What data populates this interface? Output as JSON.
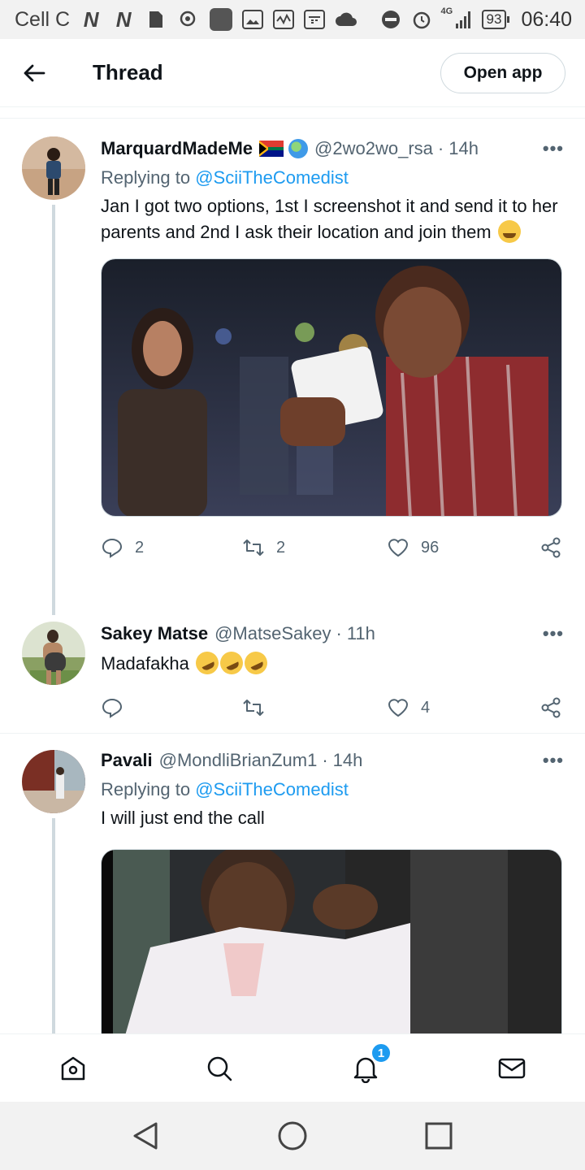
{
  "status_bar": {
    "carrier": "Cell C",
    "battery": "93",
    "network": "4G",
    "time": "06:40",
    "icons": [
      "n-icon",
      "n-icon",
      "sim-icon",
      "location-icon",
      "app-icon",
      "gallery-icon",
      "activity-icon",
      "calendar-icon",
      "cloud-icon",
      "dnd-icon",
      "alarm-icon",
      "signal-icon"
    ]
  },
  "header": {
    "title": "Thread",
    "open_app": "Open app"
  },
  "tweets": [
    {
      "name": "MarquardMadeMe",
      "handle": "@2wo2wo_rsa",
      "dot": "·",
      "time": "14h",
      "replying_label": "Replying to",
      "replying_to": "@SciiTheComedist",
      "text": "Jan I got two options, 1st I screenshot it and send it to her parents and 2nd I ask their location and join them",
      "replies": "2",
      "retweets": "2",
      "likes": "96"
    },
    {
      "name": "Sakey Matse",
      "handle": "@MatseSakey",
      "dot": "·",
      "time": "11h",
      "text": "Madafakha",
      "replies": "",
      "retweets": "",
      "likes": "4"
    },
    {
      "name": "Pavali",
      "handle": "@MondliBrianZum1",
      "dot": "·",
      "time": "14h",
      "replying_label": "Replying to",
      "replying_to": "@SciiTheComedist",
      "text": "I will just end the call"
    }
  ],
  "more_label": "•••",
  "bottom_nav": {
    "notification_count": "1"
  },
  "colors": {
    "accent": "#1d9bf0",
    "text": "#0f1419",
    "secondary": "#536471",
    "border": "#cfd9de"
  }
}
